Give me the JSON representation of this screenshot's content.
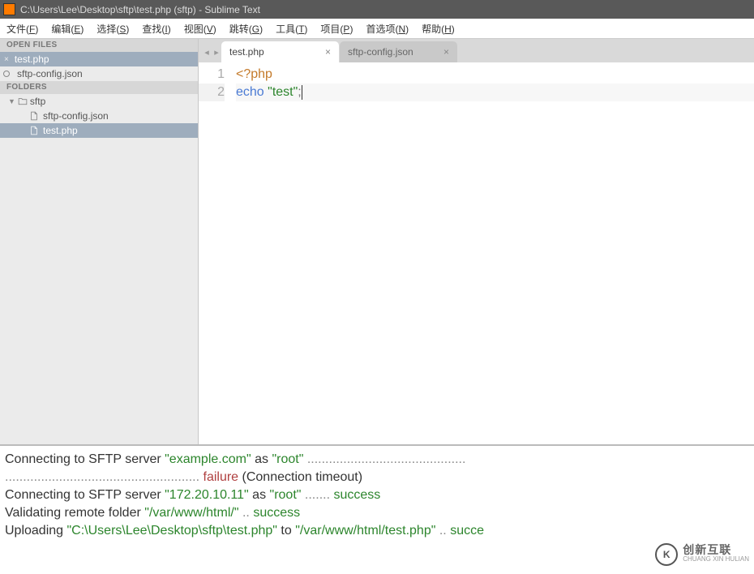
{
  "window": {
    "title": "C:\\Users\\Lee\\Desktop\\sftp\\test.php (sftp) - Sublime Text"
  },
  "menu": {
    "items": [
      {
        "label": "文件",
        "accel": "F"
      },
      {
        "label": "编辑",
        "accel": "E"
      },
      {
        "label": "选择",
        "accel": "S"
      },
      {
        "label": "查找",
        "accel": "I"
      },
      {
        "label": "视图",
        "accel": "V"
      },
      {
        "label": "跳转",
        "accel": "G"
      },
      {
        "label": "工具",
        "accel": "T"
      },
      {
        "label": "项目",
        "accel": "P"
      },
      {
        "label": "首选项",
        "accel": "N"
      },
      {
        "label": "帮助",
        "accel": "H"
      }
    ]
  },
  "sidebar": {
    "open_files_header": "OPEN FILES",
    "open_files": [
      {
        "name": "test.php",
        "selected": true,
        "dirty": false
      },
      {
        "name": "sftp-config.json",
        "selected": false,
        "dirty": true
      }
    ],
    "folders_header": "FOLDERS",
    "root_folder": "sftp",
    "tree_items": [
      {
        "name": "sftp-config.json",
        "selected": false
      },
      {
        "name": "test.php",
        "selected": true
      }
    ]
  },
  "tabs": {
    "items": [
      {
        "label": "test.php",
        "active": true
      },
      {
        "label": "sftp-config.json",
        "active": false
      }
    ]
  },
  "code": {
    "lines": [
      {
        "n": "1",
        "tokens": [
          {
            "t": "<?php",
            "c": "tok-keyword"
          }
        ]
      },
      {
        "n": "2",
        "hl": true,
        "tokens": [
          {
            "t": "echo ",
            "c": "tok-func"
          },
          {
            "t": "\"test\"",
            "c": "tok-string"
          },
          {
            "t": ";",
            "c": "tok-punct"
          }
        ],
        "cursor": true
      }
    ]
  },
  "console": {
    "lines": [
      [
        {
          "t": "Connecting to SFTP server "
        },
        {
          "t": "\"example.com\"",
          "c": "c-string"
        },
        {
          "t": " as "
        },
        {
          "t": "\"root\"",
          "c": "c-string"
        },
        {
          "t": " "
        },
        {
          "t": "............................................",
          "c": "dots"
        }
      ],
      [
        {
          "t": "...................................................... ",
          "c": "dots"
        },
        {
          "t": "failure",
          "c": "c-fail"
        },
        {
          "t": " (Connection timeout)"
        }
      ],
      [
        {
          "t": "Connecting to SFTP server "
        },
        {
          "t": "\"172.20.10.11\"",
          "c": "c-string"
        },
        {
          "t": " as "
        },
        {
          "t": "\"root\"",
          "c": "c-string"
        },
        {
          "t": " "
        },
        {
          "t": ".......",
          "c": "dots"
        },
        {
          "t": " "
        },
        {
          "t": "success",
          "c": "c-ok"
        }
      ],
      [
        {
          "t": "Validating remote folder "
        },
        {
          "t": "\"/var/www/html/\"",
          "c": "c-string"
        },
        {
          "t": " "
        },
        {
          "t": "..",
          "c": "dots"
        },
        {
          "t": " "
        },
        {
          "t": "success",
          "c": "c-ok"
        }
      ],
      [
        {
          "t": "Uploading "
        },
        {
          "t": "\"C:\\Users\\Lee\\Desktop\\sftp\\test.php\"",
          "c": "c-string"
        },
        {
          "t": " to "
        },
        {
          "t": "\"/var/www/html/test.php\"",
          "c": "c-string"
        },
        {
          "t": " "
        },
        {
          "t": "..",
          "c": "dots"
        },
        {
          "t": " "
        },
        {
          "t": "succe",
          "c": "c-ok"
        }
      ]
    ]
  },
  "watermark": {
    "brand": "创新互联",
    "sub": "CHUANG XIN HULIAN",
    "logo": "K"
  }
}
